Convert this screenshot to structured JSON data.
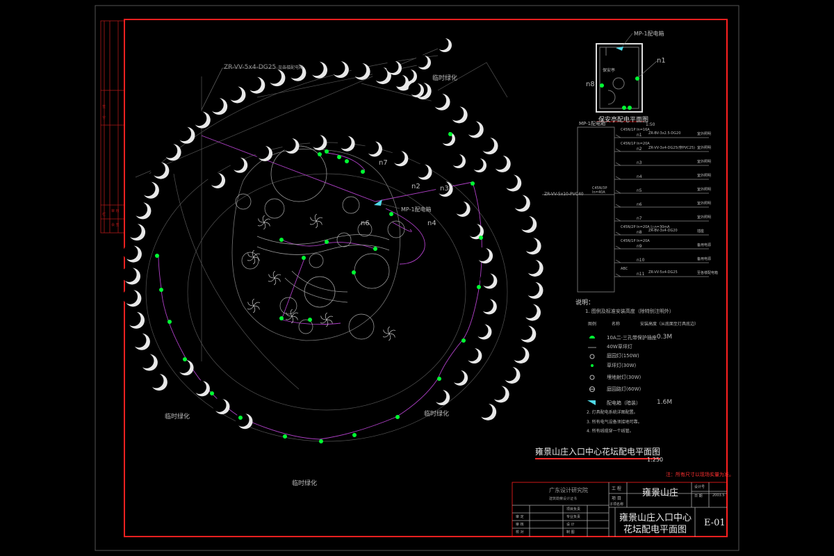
{
  "drawing_title": "雍景山庄入口中心花坛配电平面图",
  "drawing_scale": "1:250",
  "note": "注：所有尺寸以现场实量为准。",
  "site_labels": {
    "temp_green_top": "临时绿化",
    "temp_green_left": "临时绿化",
    "temp_green_right": "临时绿化",
    "temp_green_bottom": "临时绿化"
  },
  "cable_label": "ZR-VV-5x4-DG25",
  "cable_label_note": "至各楼配电箱",
  "callouts": {
    "mp1_main": "MP-1配电箱",
    "n2": "n2",
    "n3": "n3",
    "n4": "n4",
    "n6": "n6",
    "n7": "n7"
  },
  "guard_house": {
    "title": "保安亭配电平面图",
    "scale": "1:50",
    "mp1": "MP-1配电箱",
    "n1": "n1",
    "n8": "n8",
    "room": "保安亭"
  },
  "panel_schedule": {
    "title": "MP-1配电箱",
    "incoming": "ZR-VV-5x10-PVC40",
    "main_breaker": "C45N/3P  In=40A",
    "circuits": [
      {
        "id": "n1",
        "breaker": "C45N/1P In=16A",
        "cable": "ZR-BV-3x2.5-DG20",
        "use": "室外照明"
      },
      {
        "id": "n2",
        "breaker": "C45N/1P In=20A",
        "cable": "ZR-VV-3x4-DG25(穿PVC25)",
        "use": "室外照明"
      },
      {
        "id": "n3",
        "breaker": "",
        "cable": "",
        "use": "室外照明"
      },
      {
        "id": "n4",
        "breaker": "",
        "cable": "",
        "use": "室外照明"
      },
      {
        "id": "n5",
        "breaker": "",
        "cable": "",
        "use": "室外照明"
      },
      {
        "id": "n6",
        "breaker": "",
        "cable": "",
        "use": "室外照明"
      },
      {
        "id": "n7",
        "breaker": "",
        "cable": "",
        "use": "室外照明"
      },
      {
        "id": "n8",
        "breaker": "C45N/2P In=20A  I△n=30mA",
        "cable": "ZR-BV-3x4-DG20",
        "use": "插座"
      },
      {
        "id": "n9",
        "breaker": "C45N/1P In=20A",
        "cable": "",
        "use": "备用电源"
      },
      {
        "id": "n10",
        "breaker": "",
        "cable": "",
        "use": "备用电源"
      },
      {
        "id": "n11",
        "breaker": "ABC",
        "cable": "ZR-VV-5x4-DG25",
        "use": "至各楼配电箱"
      }
    ]
  },
  "legend": {
    "heading": "说明：",
    "item1": "1. 图例及标准安装高度（除特别注明外）",
    "col_symbol": "图例",
    "col_name": "名称",
    "col_height": "安装高度（从底面至灯具底边）",
    "rows": [
      {
        "name": "10A二·三孔带保护插座",
        "height": "0.3M"
      },
      {
        "name": "40W草坪灯",
        "height": ""
      },
      {
        "name": "庭园灯(150W)",
        "height": ""
      },
      {
        "name": "草坪灯(30W)",
        "height": ""
      },
      {
        "name": "埋地射灯(30W)",
        "height": ""
      },
      {
        "name": "庭园路灯(60W)",
        "height": ""
      },
      {
        "name": "配电箱（暗装）",
        "height": "1.6M"
      }
    ],
    "note2": "2. 灯具配电系统详图配置。",
    "note3": "3. 所有电气设备须接地可靠。",
    "note4": "4. 所有线缆穿一个线管。"
  },
  "title_block": {
    "institute": "广东设计研究院",
    "institute_sub": "建筑勘察设计证书",
    "project_label": "工 程",
    "project": "雍景山庄",
    "item_label": "项 目",
    "sub_label": "子项名称",
    "drawing_name_1": "雍景山庄入口中心",
    "drawing_name_2": "花坛配电平面图",
    "sheet_no": "E-01",
    "design_no_label": "设计号",
    "date_label": "日 期",
    "date": "2003.5",
    "rows_left": [
      "审 定",
      "审 核",
      "校 对"
    ],
    "rows_mid": [
      "项目负责",
      "专业负责",
      "设 计",
      "制 图"
    ]
  },
  "left_strip": [
    "签",
    "字",
    "栏",
    "审 核",
    "会 签"
  ],
  "colors": {
    "frame": "#ff2020",
    "lamp": "#00ff33",
    "wire": "#b040c8",
    "tree": "#e0e0e0",
    "text_cyan": "#4fd8e6"
  }
}
